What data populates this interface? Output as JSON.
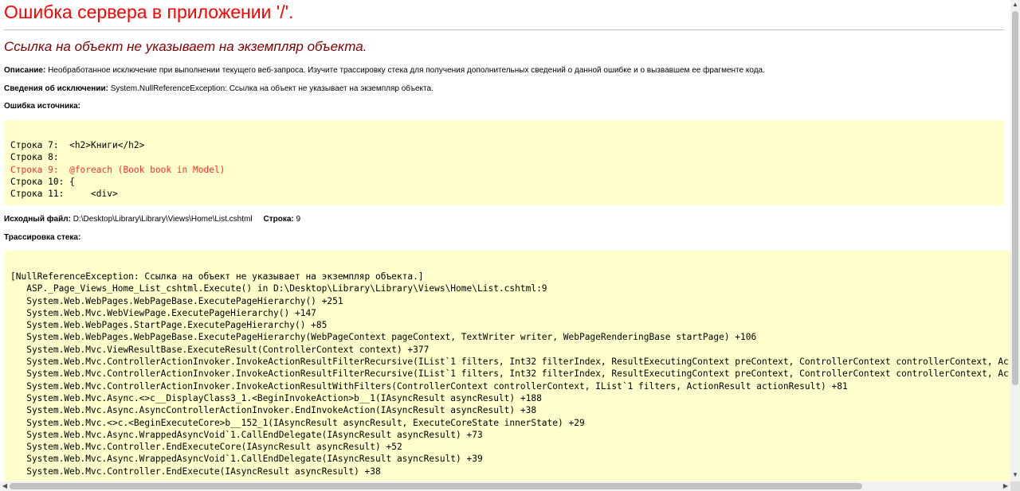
{
  "title": "Ошибка сервера в приложении '/'.",
  "subtitle": "Ссылка на объект не указывает на экземпляр объекта.",
  "description": {
    "label": "Описание:",
    "text": "Необработанное исключение при выполнении текущего веб-запроса. Изучите трассировку стека для получения дополнительных сведений о данной ошибке и о вызвавшем ее фрагменте кода."
  },
  "exception_details": {
    "label": "Сведения об исключении:",
    "text": "System.NullReferenceException: Ссылка на объект не указывает на экземпляр объекта."
  },
  "source_error": {
    "label": "Ошибка источника:",
    "lines": [
      {
        "text": "Строка 7:  <h2>Книги</h2>",
        "error": false
      },
      {
        "text": "Строка 8:",
        "error": false
      },
      {
        "text": "Строка 9:  @foreach (Book book in Model)",
        "error": true
      },
      {
        "text": "Строка 10: {",
        "error": false
      },
      {
        "text": "Строка 11:     <div>",
        "error": false
      }
    ]
  },
  "source_file": {
    "label": "Исходный файл:",
    "path": "D:\\Desktop\\Library\\Library\\Views\\Home\\List.cshtml",
    "line_label": "Строка:",
    "line_number": "9"
  },
  "stack_trace": {
    "label": "Трассировка стека:",
    "lines": [
      "[NullReferenceException: Ссылка на объект не указывает на экземпляр объекта.]",
      "   ASP._Page_Views_Home_List_cshtml.Execute() in D:\\Desktop\\Library\\Library\\Views\\Home\\List.cshtml:9",
      "   System.Web.WebPages.WebPageBase.ExecutePageHierarchy() +251",
      "   System.Web.Mvc.WebViewPage.ExecutePageHierarchy() +147",
      "   System.Web.WebPages.StartPage.ExecutePageHierarchy() +85",
      "   System.Web.WebPages.WebPageBase.ExecutePageHierarchy(WebPageContext pageContext, TextWriter writer, WebPageRenderingBase startPage) +106",
      "   System.Web.Mvc.ViewResultBase.ExecuteResult(ControllerContext context) +377",
      "   System.Web.Mvc.ControllerActionInvoker.InvokeActionResultFilterRecursive(IList`1 filters, Int32 filterIndex, ResultExecutingContext preContext, ControllerContext controllerContext, Ac",
      "   System.Web.Mvc.ControllerActionInvoker.InvokeActionResultFilterRecursive(IList`1 filters, Int32 filterIndex, ResultExecutingContext preContext, ControllerContext controllerContext, Ac",
      "   System.Web.Mvc.ControllerActionInvoker.InvokeActionResultWithFilters(ControllerContext controllerContext, IList`1 filters, ActionResult actionResult) +81",
      "   System.Web.Mvc.Async.<>c__DisplayClass3_1.<BeginInvokeAction>b__1(IAsyncResult asyncResult) +188",
      "   System.Web.Mvc.Async.AsyncControllerActionInvoker.EndInvokeAction(IAsyncResult asyncResult) +38",
      "   System.Web.Mvc.<>c.<BeginExecuteCore>b__152_1(IAsyncResult asyncResult, ExecuteCoreState innerState) +29",
      "   System.Web.Mvc.Async.WrappedAsyncVoid`1.CallEndDelegate(IAsyncResult asyncResult) +73",
      "   System.Web.Mvc.Controller.EndExecuteCore(IAsyncResult asyncResult) +52",
      "   System.Web.Mvc.Async.WrappedAsyncVoid`1.CallEndDelegate(IAsyncResult asyncResult) +39",
      "   System.Web.Mvc.Controller.EndExecute(IAsyncResult asyncResult) +38"
    ]
  },
  "scrollbar": {
    "up_arrow": "▲",
    "down_arrow": "▼",
    "left_arrow": "◀",
    "right_arrow": "▶"
  }
}
